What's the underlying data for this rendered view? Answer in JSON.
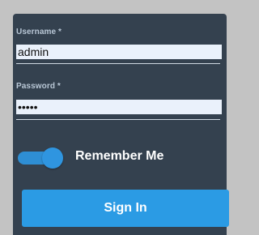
{
  "login": {
    "username_label": "Username *",
    "username_value": "admin",
    "password_label": "Password *",
    "password_value": "•••••",
    "remember_label": "Remember Me",
    "remember_checked": true,
    "signin_label": "Sign In"
  },
  "colors": {
    "panel_bg": "#34414f",
    "accent": "#2b9be4",
    "page_bg": "#c3c3c3"
  }
}
